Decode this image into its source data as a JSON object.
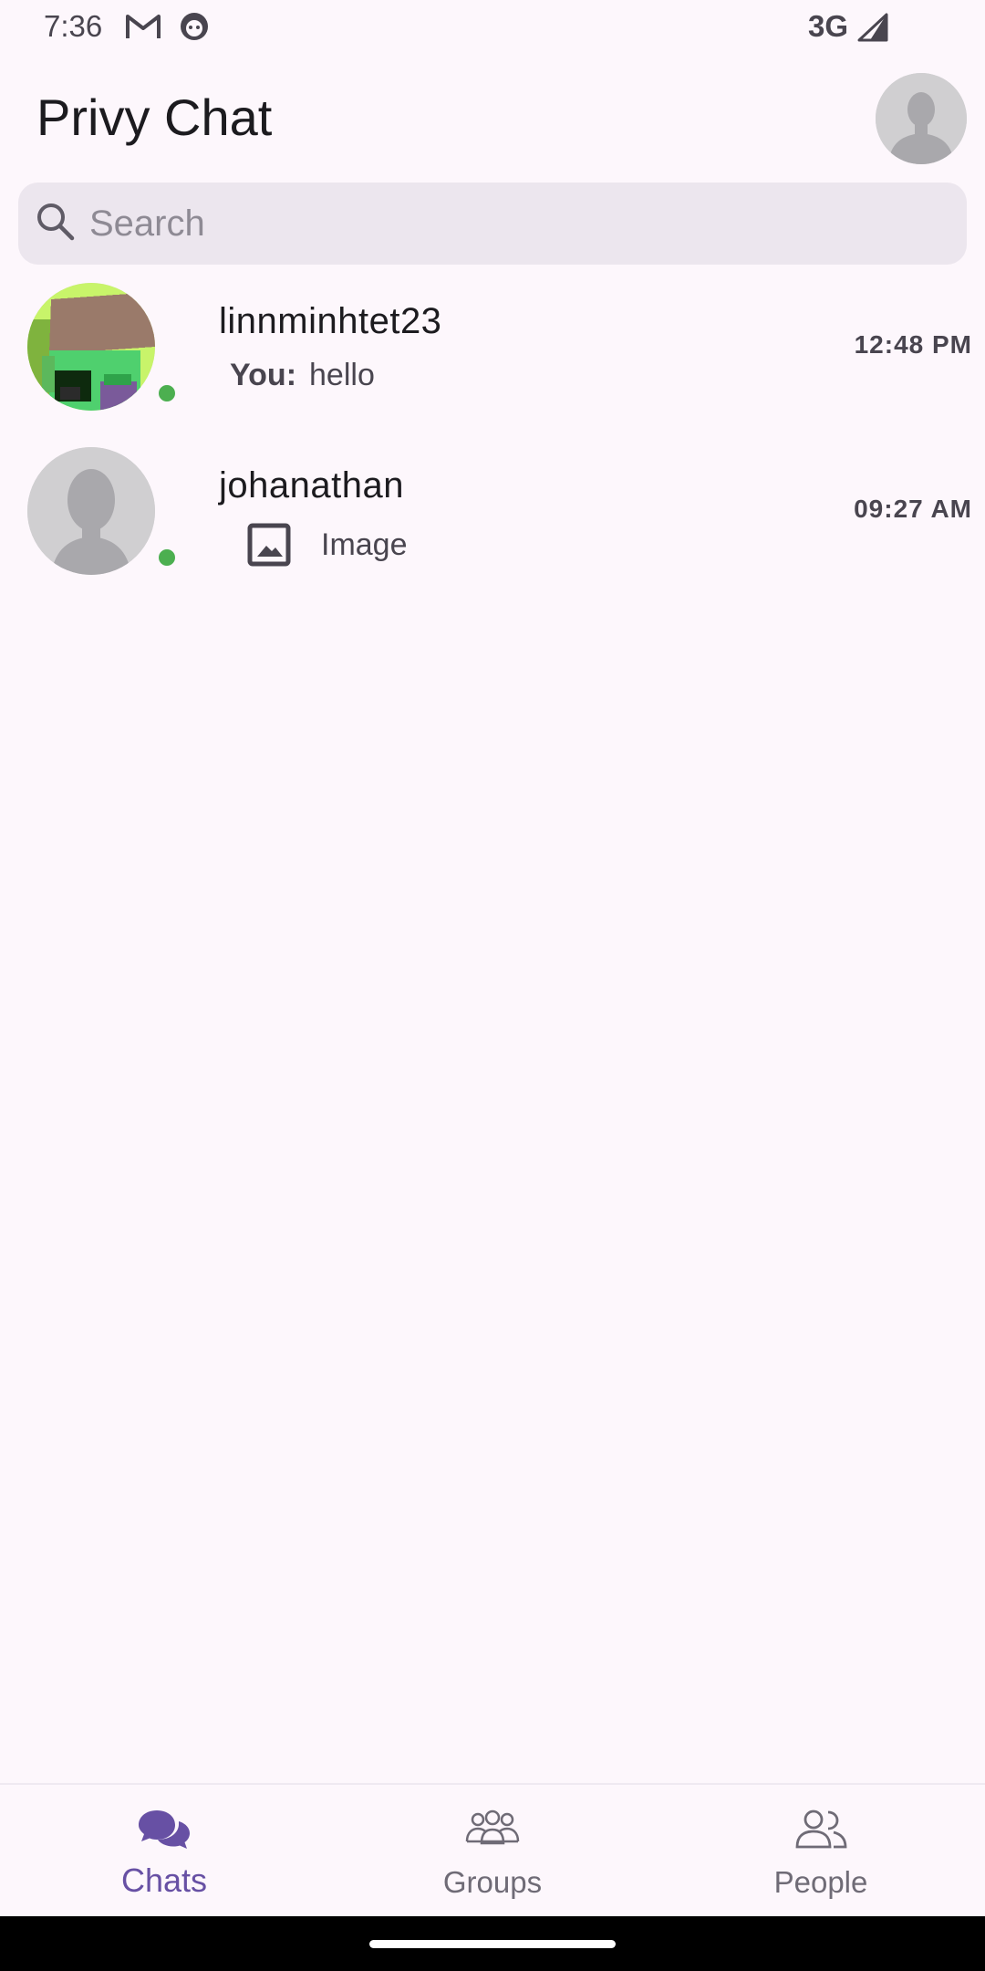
{
  "status_bar": {
    "time": "7:36",
    "network": "3G",
    "icons": [
      "gmail-icon",
      "app-notification-icon",
      "signal-icon"
    ]
  },
  "app_bar": {
    "title": "Privy Chat"
  },
  "search": {
    "placeholder": "Search",
    "value": ""
  },
  "chats": [
    {
      "name": "linnminhtet23",
      "preview_sender": "You:",
      "preview_text": "hello",
      "time": "12:48 PM",
      "online": true,
      "avatar": "pixel-art-avatar"
    },
    {
      "name": "johanathan",
      "preview_text": "Image",
      "preview_icon": "image-icon",
      "time": "09:27 AM",
      "online": true,
      "avatar": "default-person-avatar"
    }
  ],
  "bottom_nav": {
    "items": [
      {
        "label": "Chats",
        "icon": "chat-bubbles-icon",
        "active": true
      },
      {
        "label": "Groups",
        "icon": "groups-icon",
        "active": false
      },
      {
        "label": "People",
        "icon": "people-icon",
        "active": false
      }
    ]
  },
  "colors": {
    "background": "#FDF7FC",
    "accent": "#6750A4",
    "online": "#4CAF50",
    "search_bg": "#ECE6EE"
  }
}
